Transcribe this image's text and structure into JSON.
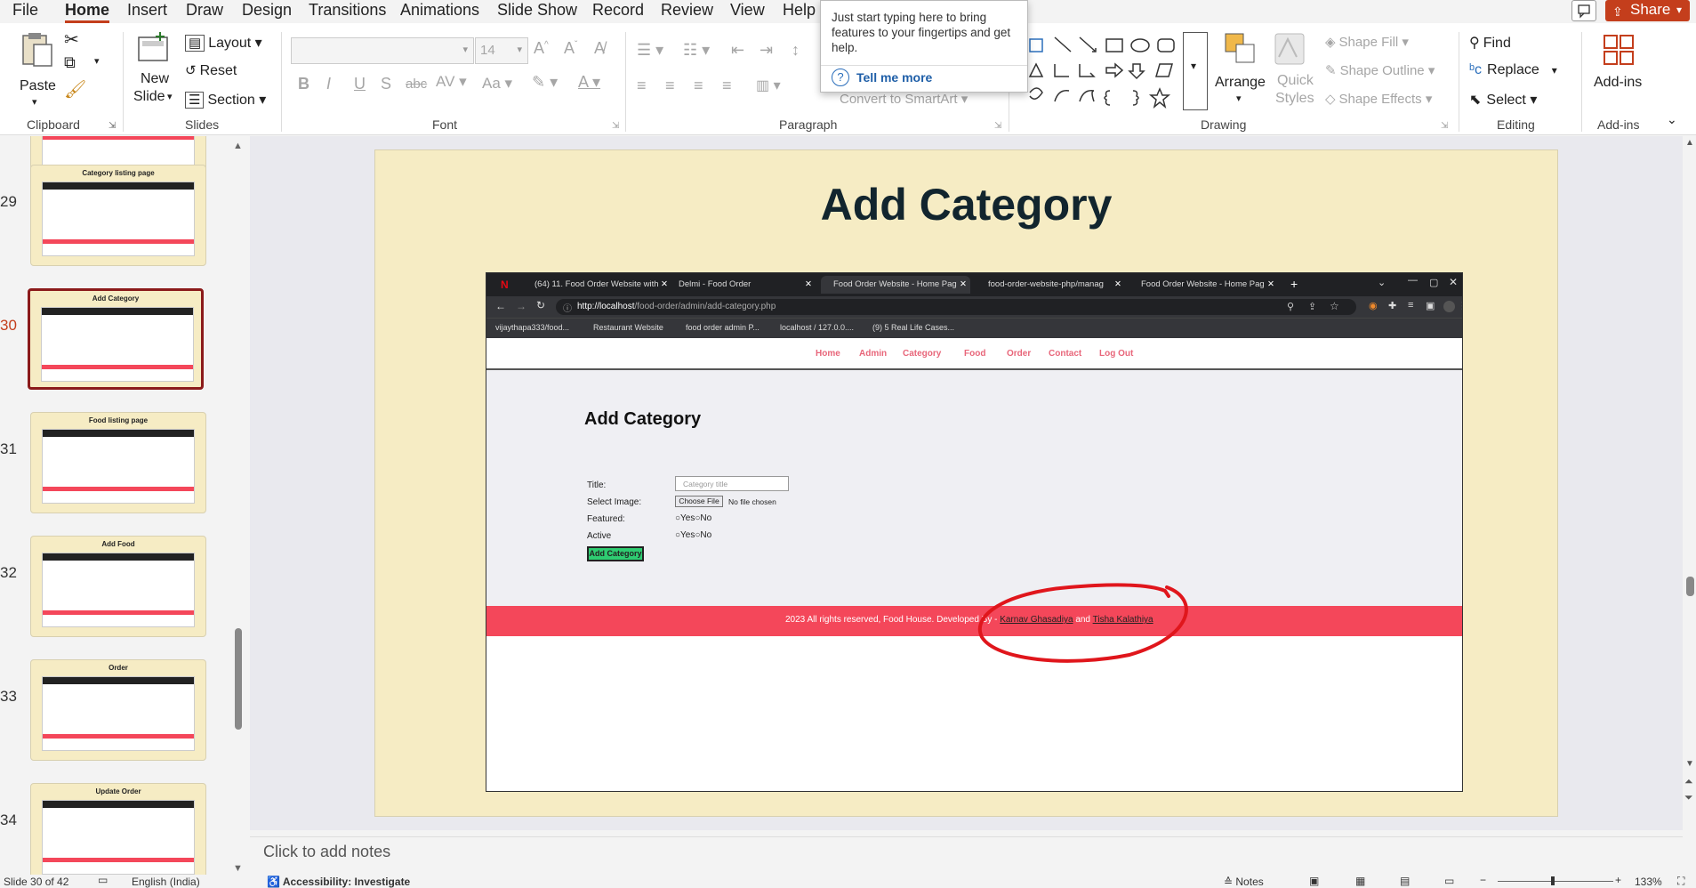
{
  "menu": {
    "items": [
      "File",
      "Home",
      "Insert",
      "Draw",
      "Design",
      "Transitions",
      "Animations",
      "Slide Show",
      "Record",
      "Review",
      "View",
      "Help"
    ],
    "active": "Home",
    "share_label": "Share"
  },
  "ribbon": {
    "clipboard": {
      "group": "Clipboard",
      "paste": "Paste"
    },
    "slides": {
      "group": "Slides",
      "new_slide_1": "New",
      "new_slide_2": "Slide",
      "layout": "Layout",
      "reset": "Reset",
      "section": "Section"
    },
    "font": {
      "group": "Font",
      "size": "14",
      "bold": "B",
      "italic": "I",
      "underline": "U",
      "strike": "S",
      "abc": "abc",
      "spacing": "AV",
      "case": "Aa"
    },
    "paragraph": {
      "group": "Paragraph",
      "convert_smartart": "Convert to SmartArt"
    },
    "drawing": {
      "group": "Drawing",
      "arrange": "Arrange",
      "quick_styles_1": "Quick",
      "quick_styles_2": "Styles",
      "shape_fill": "Shape Fill",
      "shape_outline": "Shape Outline",
      "shape_effects": "Shape Effects"
    },
    "editing": {
      "group": "Editing",
      "find": "Find",
      "replace": "Replace",
      "select": "Select"
    },
    "addins": {
      "group": "Add-ins",
      "label": "Add-ins"
    }
  },
  "tooltip": {
    "text": "Just start typing here to bring features to your fingertips and get help.",
    "link": "Tell me more"
  },
  "thumbnails": [
    {
      "num": "29",
      "title": "Category listing page"
    },
    {
      "num": "30",
      "title": "Add Category",
      "selected": true
    },
    {
      "num": "31",
      "title": "Food listing page"
    },
    {
      "num": "32",
      "title": "Add Food"
    },
    {
      "num": "33",
      "title": "Order"
    },
    {
      "num": "34",
      "title": "Update Order"
    }
  ],
  "slide": {
    "title": "Add Category",
    "browser": {
      "tabs": [
        "(64) 11. Food Order Website with",
        "Delmi - Food Order",
        "Food Order Website - Home Pag",
        "food-order-website-php/manag",
        "Food Order Website - Home Pag"
      ],
      "url_host": "http://localhost",
      "url_path": "/food-order/admin/add-category.php",
      "bookmarks": [
        "vijaythapa333/food...",
        "Restaurant Website",
        "food order admin P...",
        "localhost / 127.0.0....",
        "(9) 5 Real Life Cases..."
      ]
    },
    "site": {
      "nav": [
        "Home",
        "Admin",
        "Category",
        "Food",
        "Order",
        "Contact",
        "Log Out"
      ],
      "heading": "Add Category",
      "form": {
        "title_label": "Title:",
        "title_placeholder": "Category title",
        "image_label": "Select Image:",
        "choose_file": "Choose File",
        "no_file": "No file chosen",
        "featured_label": "Featured:",
        "active_label": "Active",
        "yes": "Yes",
        "no": "No",
        "submit": "Add Category"
      },
      "footer": {
        "text": "2023 All rights reserved, Food House. Developed By -",
        "author1": "Karnav Ghasadiya",
        "and": "and",
        "author2": "Tisha Kalathiya"
      }
    }
  },
  "notes": {
    "placeholder": "Click to add notes"
  },
  "status": {
    "slide": "Slide 30 of 42",
    "language": "English (India)",
    "accessibility": "Accessibility: Investigate",
    "notes": "Notes",
    "zoom": "133%"
  },
  "colors": {
    "accent": "#c43e1c",
    "slide_bg": "#f6ecc4",
    "footer_red": "#f4475a",
    "nav_pink": "#e8667a",
    "annotation": "#e0161c"
  }
}
